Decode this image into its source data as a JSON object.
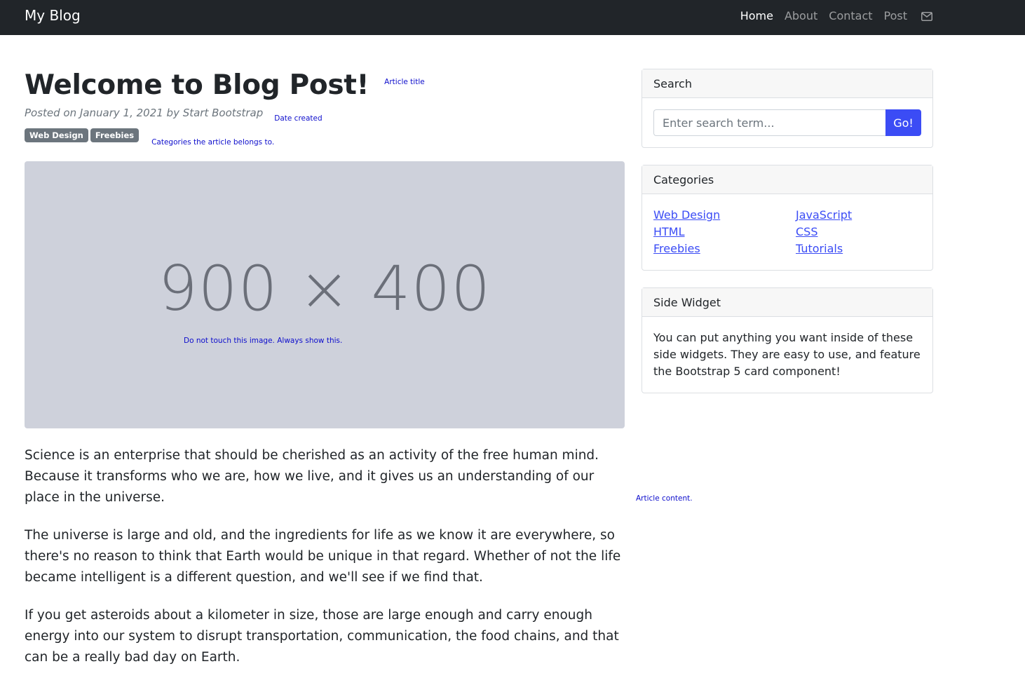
{
  "navbar": {
    "brand": "My Blog",
    "links": [
      {
        "label": "Home",
        "active": true
      },
      {
        "label": "About",
        "active": false
      },
      {
        "label": "Contact",
        "active": false
      },
      {
        "label": "Post",
        "active": false
      }
    ],
    "mail_icon": "envelope-icon"
  },
  "post": {
    "title": "Welcome to Blog Post!",
    "title_hint": "Article title",
    "meta": "Posted on January 1, 2021 by Start Bootstrap",
    "date_hint": "Date created",
    "badges": [
      "Web Design",
      "Freebies"
    ],
    "categories_hint": "Categories the article belongs to.",
    "image_text": "900 × 400",
    "image_hint": "Do not touch this image. Always show this.",
    "paragraphs": [
      "Science is an enterprise that should be cherished as an activity of the free human mind. Because it transforms who we are, how we live, and it gives us an understanding of our place in the universe.",
      "The universe is large and old, and the ingredients for life as we know it are everywhere, so there's no reason to think that Earth would be unique in that regard. Whether of not the life became intelligent is a different question, and we'll see if we find that.",
      "If you get asteroids about a kilometer in size, those are large enough and carry enough energy into our system to disrupt transportation, communication, the food chains, and that can be a really bad day on Earth."
    ],
    "content_hint": "Article content."
  },
  "sidebar": {
    "search": {
      "header": "Search",
      "placeholder": "Enter search term...",
      "button": "Go!"
    },
    "categories": {
      "header": "Categories",
      "left": [
        "Web Design",
        "HTML",
        "Freebies"
      ],
      "right": [
        "JavaScript",
        "CSS",
        "Tutorials"
      ]
    },
    "widget": {
      "header": "Side Widget",
      "text": "You can put anything you want inside of these side widgets. They are easy to use, and feature the Bootstrap 5 card component!"
    }
  },
  "colors": {
    "navbar_bg": "#212529",
    "accent": "#3b4cf5",
    "badge_bg": "#6c757d",
    "placeholder_bg": "#ced1db",
    "hint_text": "#0d0dcc"
  }
}
